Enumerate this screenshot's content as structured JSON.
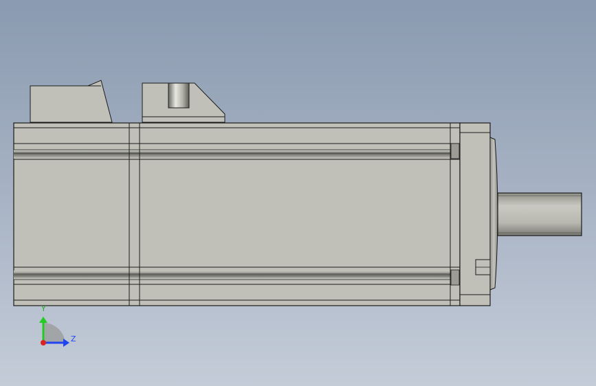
{
  "view": {
    "background_top": "#8a9ab0",
    "background_bottom": "#c4ccd8",
    "body_color": "#c0c0b8",
    "edge_color": "#1a1a1a"
  },
  "triad": {
    "y_label": "Y",
    "z_label": "Z",
    "y_color": "#22cc22",
    "z_color": "#2244ee",
    "x_color": "#dd2222"
  }
}
